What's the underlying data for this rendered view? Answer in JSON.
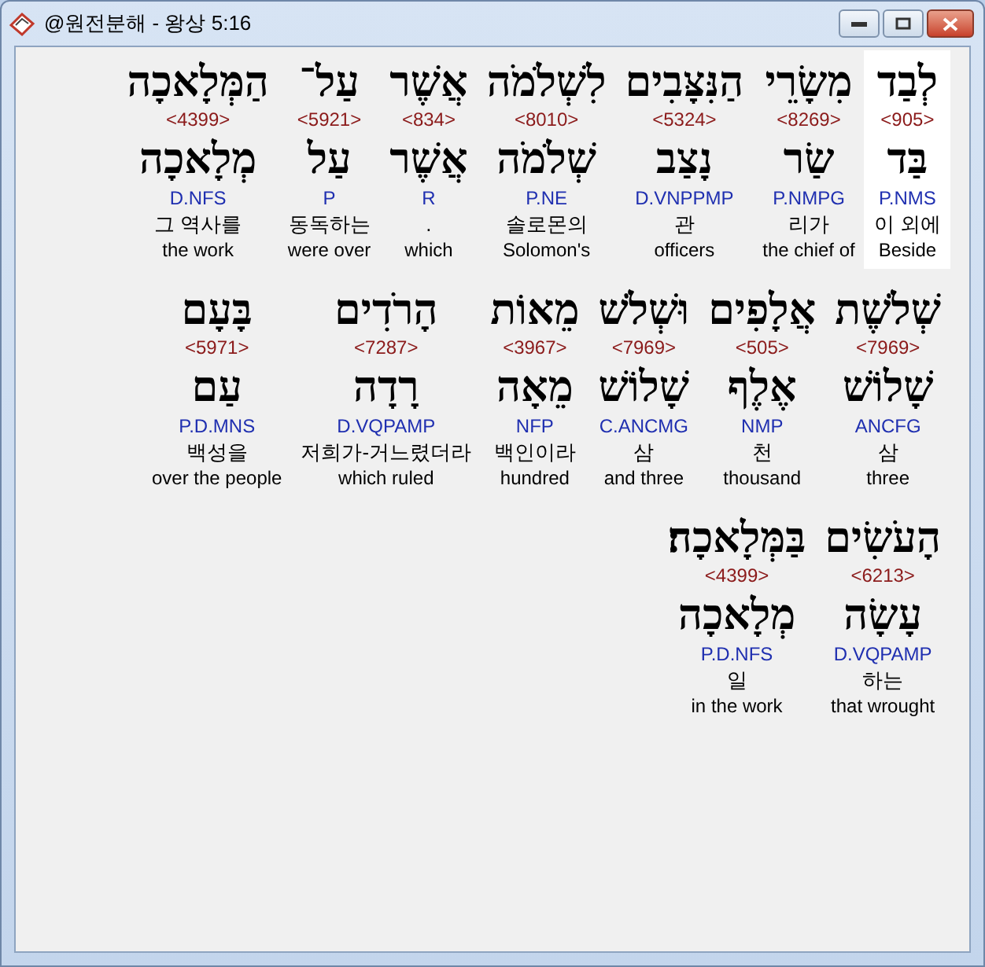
{
  "window": {
    "title": "@원전분해 - 왕상 5:16"
  },
  "words": [
    {
      "hebrew": "לְבַד",
      "strong": "<905>",
      "lemma": "בַּד",
      "parse": "P.NMS",
      "korean": "이 외에",
      "english": "Beside",
      "selected": true
    },
    {
      "hebrew": "מִשָׂרֵי",
      "strong": "<8269>",
      "lemma": "שַׂר",
      "parse": "P.NMPG",
      "korean": "리가",
      "english": "the chief of",
      "selected": false
    },
    {
      "hebrew": "הַנִּצָּבִים",
      "strong": "<5324>",
      "lemma": "נָצַב",
      "parse": "D.VNPPMP",
      "korean": "관",
      "english": "officers",
      "selected": false
    },
    {
      "hebrew": "לִשְׁלֹמֹה",
      "strong": "<8010>",
      "lemma": "שְׁלֹמֹה",
      "parse": "P.NE",
      "korean": "솔로몬의",
      "english": "Solomon's",
      "selected": false
    },
    {
      "hebrew": "אֲשֶׁר",
      "strong": "<834>",
      "lemma": "אֲשֶׁר",
      "parse": "R",
      "korean": ".",
      "english": "which",
      "selected": false
    },
    {
      "hebrew": "עַל־",
      "strong": "<5921>",
      "lemma": "עַל",
      "parse": "P",
      "korean": "동독하는",
      "english": "were over",
      "selected": false
    },
    {
      "hebrew": "הַמְּלָאכָה",
      "strong": "<4399>",
      "lemma": "מְלָאכָה",
      "parse": "D.NFS",
      "korean": "그 역사를",
      "english": "the work",
      "selected": false
    },
    {
      "hebrew": "שְׁלֹשֶׁת",
      "strong": "<7969>",
      "lemma": "שָׁלוֹשׁ",
      "parse": "ANCFG",
      "korean": "삼",
      "english": "three",
      "selected": false
    },
    {
      "hebrew": "אֲלָפִים",
      "strong": "<505>",
      "lemma": "אֶלֶף",
      "parse": "NMP",
      "korean": "천",
      "english": "thousand",
      "selected": false
    },
    {
      "hebrew": "וּשְׁלֹשׁ",
      "strong": "<7969>",
      "lemma": "שָׁלוֹשׁ",
      "parse": "C.ANCMG",
      "korean": "삼",
      "english": "and three",
      "selected": false
    },
    {
      "hebrew": "מֵאוֹת",
      "strong": "<3967>",
      "lemma": "מֵאָה",
      "parse": "NFP",
      "korean": "백인이라",
      "english": "hundred",
      "selected": false
    },
    {
      "hebrew": "הָרֹדִים",
      "strong": "<7287>",
      "lemma": "רָדָה",
      "parse": "D.VQPAMP",
      "korean": "저희가-거느렸더라",
      "english": "which ruled",
      "selected": false
    },
    {
      "hebrew": "בָּעָם",
      "strong": "<5971>",
      "lemma": "עַם",
      "parse": "P.D.MNS",
      "korean": "백성을",
      "english": "over the people",
      "selected": false
    },
    {
      "hebrew": "הָעֹשִׂים",
      "strong": "<6213>",
      "lemma": "עָשָׂה",
      "parse": "D.VQPAMP",
      "korean": "하는",
      "english": "that wrought",
      "selected": false
    },
    {
      "hebrew": "בַּמְּלָאכָה׃",
      "strong": "<4399>",
      "lemma": "מְלָאכָה",
      "parse": "P.D.NFS",
      "korean": "일",
      "english": "in the work",
      "selected": false
    }
  ]
}
